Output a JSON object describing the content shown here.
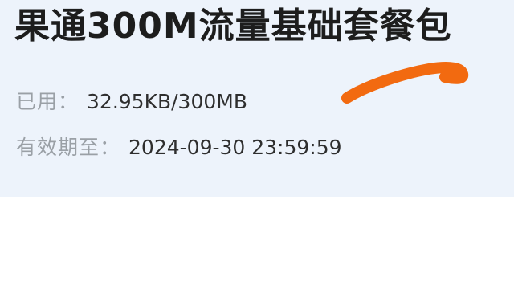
{
  "package": {
    "title": "果通300M流量基础套餐包",
    "used_label": "已用：",
    "used_value": "32.95KB/300MB",
    "expire_label": "有效期至：",
    "expire_value": "2024-09-30 23:59:59"
  },
  "colors": {
    "card_background": "#edf3fb",
    "title": "#1d1d1d",
    "label": "#9aa0a6",
    "value": "#2e2e2e",
    "annotation_stroke": "#f26a10"
  },
  "annotation": {
    "type": "freehand-stroke"
  }
}
